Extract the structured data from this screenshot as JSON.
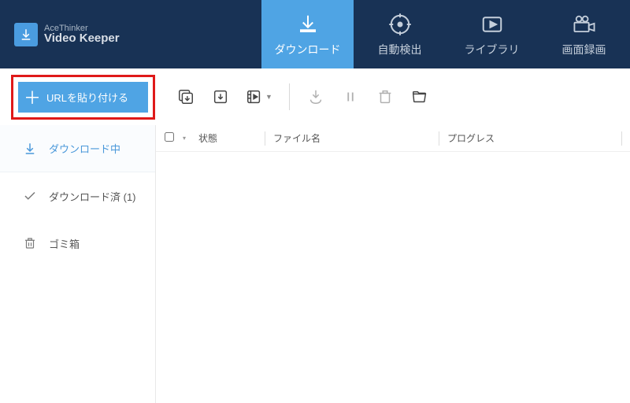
{
  "brand": {
    "line1": "AceThinker",
    "line2": "Video Keeper"
  },
  "nav": {
    "download": "ダウンロード",
    "detect": "自動検出",
    "library": "ライブラリ",
    "record": "画面録画"
  },
  "paste_btn": "URLを貼り付ける",
  "sidebar": {
    "downloading": "ダウンロード中",
    "downloaded": "ダウンロード済 (1)",
    "trash": "ゴミ箱"
  },
  "columns": {
    "status": "状態",
    "filename": "ファイル名",
    "progress": "プログレス"
  }
}
